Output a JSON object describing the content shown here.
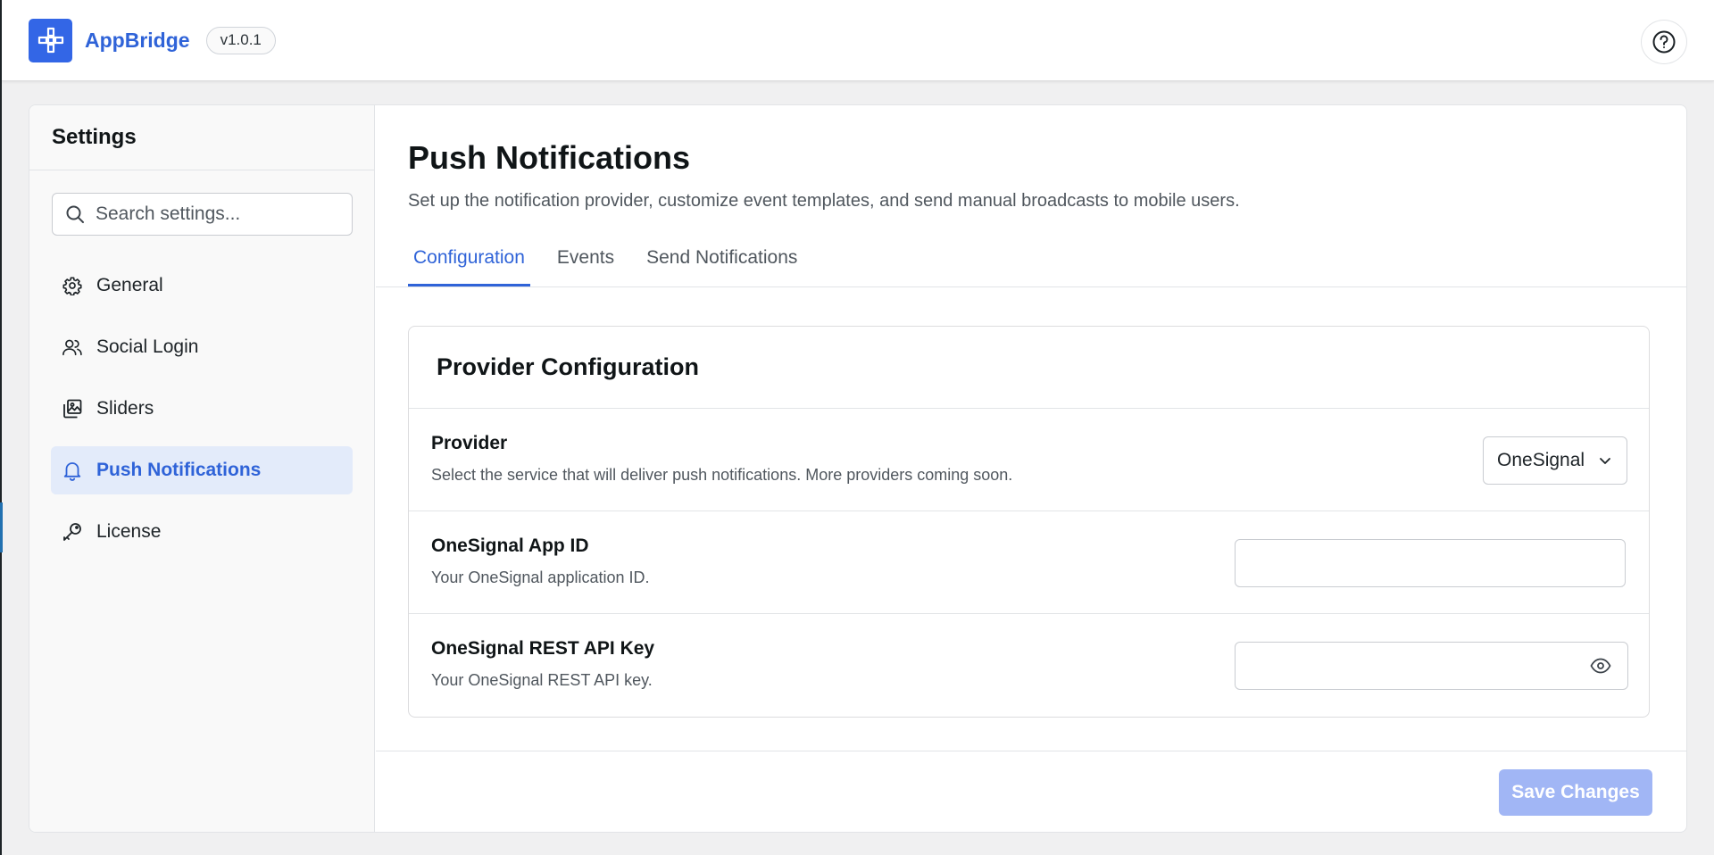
{
  "app": {
    "name": "AppBridge",
    "version": "v1.0.1",
    "icons": {
      "logo": "plus-knot-icon",
      "help": "question-circle-icon"
    }
  },
  "sidebar": {
    "title": "Settings",
    "search_placeholder": "Search settings...",
    "items": [
      {
        "label": "General",
        "icon": "gear-icon",
        "active": false
      },
      {
        "label": "Social Login",
        "icon": "users-icon",
        "active": false
      },
      {
        "label": "Sliders",
        "icon": "images-icon",
        "active": false
      },
      {
        "label": "Push Notifications",
        "icon": "bell-icon",
        "active": true
      },
      {
        "label": "License",
        "icon": "key-icon",
        "active": false
      }
    ]
  },
  "main": {
    "title": "Push Notifications",
    "description": "Set up the notification provider, customize event templates, and send manual broadcasts to mobile users.",
    "tabs": [
      {
        "label": "Configuration",
        "active": true
      },
      {
        "label": "Events",
        "active": false
      },
      {
        "label": "Send Notifications",
        "active": false
      }
    ],
    "section": {
      "title": "Provider Configuration",
      "provider": {
        "label": "Provider",
        "help": "Select the service that will deliver push notifications. More providers coming soon.",
        "value": "OneSignal"
      },
      "app_id": {
        "label": "OneSignal App ID",
        "help": "Your OneSignal application ID.",
        "value": ""
      },
      "api_key": {
        "label": "OneSignal REST API Key",
        "help": "Your OneSignal REST API key.",
        "value": ""
      }
    },
    "save_label": "Save Changes"
  },
  "colors": {
    "accent": "#2f63d8",
    "logo_bg": "#3366e6",
    "active_nav_bg": "#e3ebfa",
    "save_disabled": "#a1b6f5"
  }
}
